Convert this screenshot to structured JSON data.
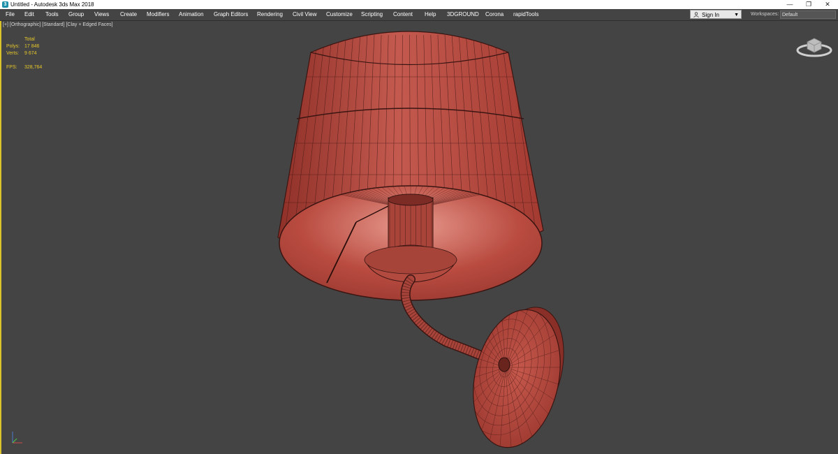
{
  "window": {
    "title": "Untitled - Autodesk 3ds Max 2018",
    "app_icon": "3ds-max-icon",
    "controls": {
      "minimize": "—",
      "restore": "❐",
      "close": "✕"
    }
  },
  "menu": [
    "File",
    "Edit",
    "Tools",
    "Group",
    "Views",
    "Create",
    "Modifiers",
    "Animation",
    "Graph Editors",
    "Rendering",
    "Civil View",
    "Customize",
    "Scripting",
    "Content",
    "Help",
    "3DGROUND",
    "Corona",
    "rapidTools"
  ],
  "signin": {
    "label": "Sign In"
  },
  "workspace": {
    "label": "Workspaces:",
    "value": "Default"
  },
  "viewport": {
    "label": "[+] [Orthographic] [Standard] [Clay + Edged Faces]",
    "stats": {
      "header": "Total",
      "polys_label": "Polys:",
      "polys_value": "17 846",
      "verts_label": "Verts:",
      "verts_value": "9 674",
      "fps_label": "FPS:",
      "fps_value": "328,764"
    }
  },
  "colors": {
    "viewport_bg": "#444444",
    "model": "#b5463d",
    "stats": "#e6c82a",
    "active_border": "#d9c22a"
  }
}
